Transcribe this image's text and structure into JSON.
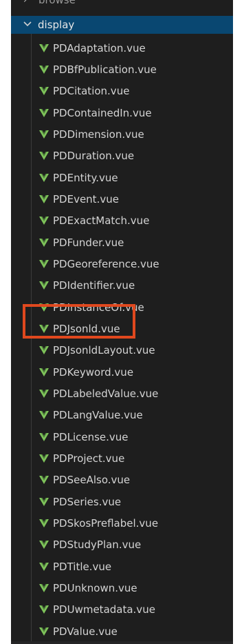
{
  "explorer": {
    "parent_folder": {
      "label": "browse",
      "chevron_icon": "chevron-right-icon"
    },
    "open_folder": {
      "label": "display",
      "chevron_icon": "chevron-down-icon"
    },
    "file_icon": "vue-icon",
    "file_icon_color": "#7ec35a",
    "selection_color": "#094771",
    "highlight_color": "#e0481e",
    "files": [
      {
        "name": "PDAdaptation.vue"
      },
      {
        "name": "PDBfPublication.vue"
      },
      {
        "name": "PDCitation.vue"
      },
      {
        "name": "PDContainedIn.vue"
      },
      {
        "name": "PDDimension.vue"
      },
      {
        "name": "PDDuration.vue"
      },
      {
        "name": "PDEntity.vue"
      },
      {
        "name": "PDEvent.vue"
      },
      {
        "name": "PDExactMatch.vue"
      },
      {
        "name": "PDFunder.vue"
      },
      {
        "name": "PDGeoreference.vue"
      },
      {
        "name": "PDIdentifier.vue"
      },
      {
        "name": "PDInstanceOf.vue"
      },
      {
        "name": "PDJsonld.vue",
        "highlighted": true
      },
      {
        "name": "PDJsonldLayout.vue"
      },
      {
        "name": "PDKeyword.vue"
      },
      {
        "name": "PDLabeledValue.vue"
      },
      {
        "name": "PDLangValue.vue"
      },
      {
        "name": "PDLicense.vue"
      },
      {
        "name": "PDProject.vue"
      },
      {
        "name": "PDSeeAlso.vue"
      },
      {
        "name": "PDSeries.vue"
      },
      {
        "name": "PDSkosPreflabel.vue"
      },
      {
        "name": "PDStudyPlan.vue"
      },
      {
        "name": "PDTitle.vue"
      },
      {
        "name": "PDUnknown.vue"
      },
      {
        "name": "PDUwmetadata.vue"
      },
      {
        "name": "PDValue.vue"
      }
    ]
  }
}
